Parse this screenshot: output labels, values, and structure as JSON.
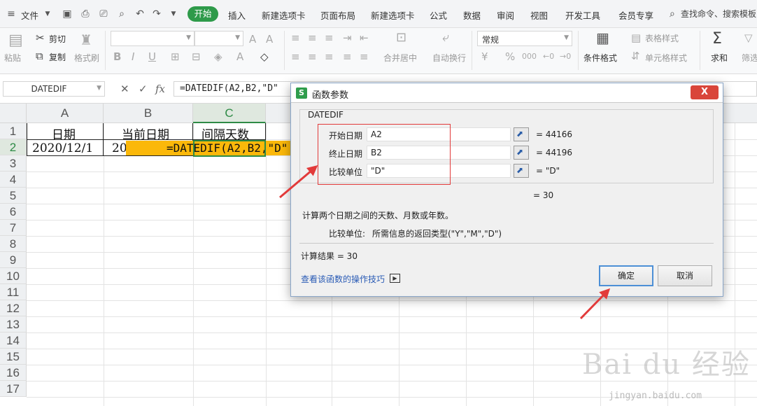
{
  "menubar": {
    "file_label": "文件",
    "tabs": [
      "开始",
      "插入",
      "新建选项卡",
      "页面布局",
      "新建选项卡",
      "公式",
      "数据",
      "审阅",
      "视图",
      "开发工具",
      "会员专享"
    ],
    "search_label": "查找命令、搜索模板"
  },
  "ribbon": {
    "paste": "粘贴",
    "cut": "剪切",
    "copy": "复制",
    "format_painter": "格式刷",
    "merge_center": "合并居中",
    "wrap_text": "自动换行",
    "number_format": "常规",
    "conditional_format": "条件格式",
    "table_style": "表格样式",
    "cell_style": "单元格样式",
    "sum": "求和",
    "filter": "筛选",
    "currency_symbol": "¥",
    "percent_symbol": "%",
    "thousands_symbol": "000"
  },
  "formula_bar": {
    "name_box": "DATEDIF",
    "formula": "=DATEDIF(A2,B2,\"D\""
  },
  "sheet": {
    "columns": [
      "A",
      "B",
      "C"
    ],
    "rows": [
      "1",
      "2",
      "3",
      "4",
      "5",
      "6",
      "7",
      "8",
      "9",
      "10",
      "11",
      "12",
      "13",
      "14",
      "15",
      "16",
      "17"
    ],
    "cells": {
      "A1": "日期",
      "B1": "当前日期",
      "C1": "间隔天数",
      "A2": "2020/12/1",
      "B2": "20",
      "C2_formula": "=DATEDIF(A2,B2,\"D\""
    }
  },
  "dialog": {
    "title": "函数参数",
    "close_label": "X",
    "group_title": "DATEDIF",
    "params": [
      {
        "label": "开始日期",
        "value": "A2",
        "result": "=  44166"
      },
      {
        "label": "终止日期",
        "value": "B2",
        "result": "=  44196"
      },
      {
        "label": "比较单位",
        "value": "\"D\"",
        "result": "=  \"D\""
      }
    ],
    "formula_result": "=  30",
    "description": "计算两个日期之间的天数、月数或年数。",
    "param_help_label": "比较单位:",
    "param_help_text": "所需信息的返回类型(\"Y\",\"M\",\"D\")",
    "calc_result": "计算结果  =  30",
    "tips_link": "查看该函数的操作技巧",
    "ok_label": "确定",
    "cancel_label": "取消"
  },
  "watermark": {
    "brand": "Bai du 经验",
    "url": "jingyan.baidu.com"
  },
  "colors": {
    "accent_green": "#2e9a4a",
    "highlight_fill": "#fbb80a",
    "annotation_red": "#e23a3a",
    "link_blue": "#2a5bb5"
  }
}
